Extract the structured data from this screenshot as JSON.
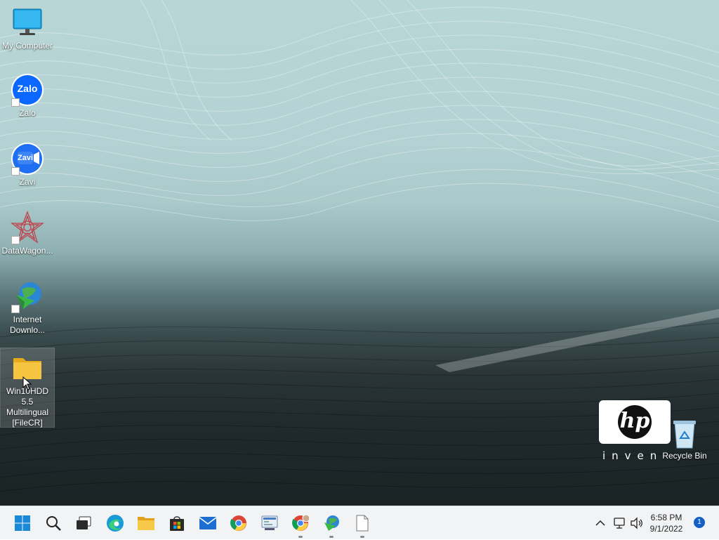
{
  "desktop": {
    "icons": [
      {
        "name": "my-computer",
        "label": "My Computer"
      },
      {
        "name": "zalo",
        "label": "Zalo",
        "art_text": "Zalo"
      },
      {
        "name": "zavi",
        "label": "Zavi",
        "art_text": "Zavi"
      },
      {
        "name": "datawagon",
        "label": "DataWagon..."
      },
      {
        "name": "internet-download-manager",
        "label": "Internet Downlo..."
      },
      {
        "name": "win10hdd-folder",
        "label": "Win10HDD 5.5 Multilingual [FileCR]"
      }
    ],
    "recycle_bin": {
      "label": "Recycle Bin"
    },
    "branding": {
      "logo_text": "hp",
      "tagline": "inven"
    }
  },
  "taskbar": {
    "apps": [
      {
        "name": "start",
        "icon": "windows-logo-icon"
      },
      {
        "name": "search",
        "icon": "search-icon"
      },
      {
        "name": "task-view",
        "icon": "task-view-icon"
      },
      {
        "name": "edge",
        "icon": "edge-icon"
      },
      {
        "name": "file-explorer",
        "icon": "folder-icon"
      },
      {
        "name": "microsoft-store",
        "icon": "store-icon"
      },
      {
        "name": "mail",
        "icon": "mail-icon"
      },
      {
        "name": "chrome",
        "icon": "chrome-icon"
      },
      {
        "name": "control-panel",
        "icon": "control-panel-icon"
      },
      {
        "name": "chrome-profile",
        "icon": "chrome-icon",
        "running": true
      },
      {
        "name": "internet-download-manager",
        "icon": "idm-icon",
        "running": true
      },
      {
        "name": "notepad",
        "icon": "document-icon",
        "running": true
      }
    ],
    "tray": {
      "time": "6:58 PM",
      "date": "9/1/2022",
      "notification_count": "1"
    }
  },
  "colors": {
    "taskbar_bg": "#f2f3f5",
    "accent_blue": "#1560c8",
    "zalo_blue": "#0a68ff",
    "folder_yellow": "#f5c542"
  }
}
